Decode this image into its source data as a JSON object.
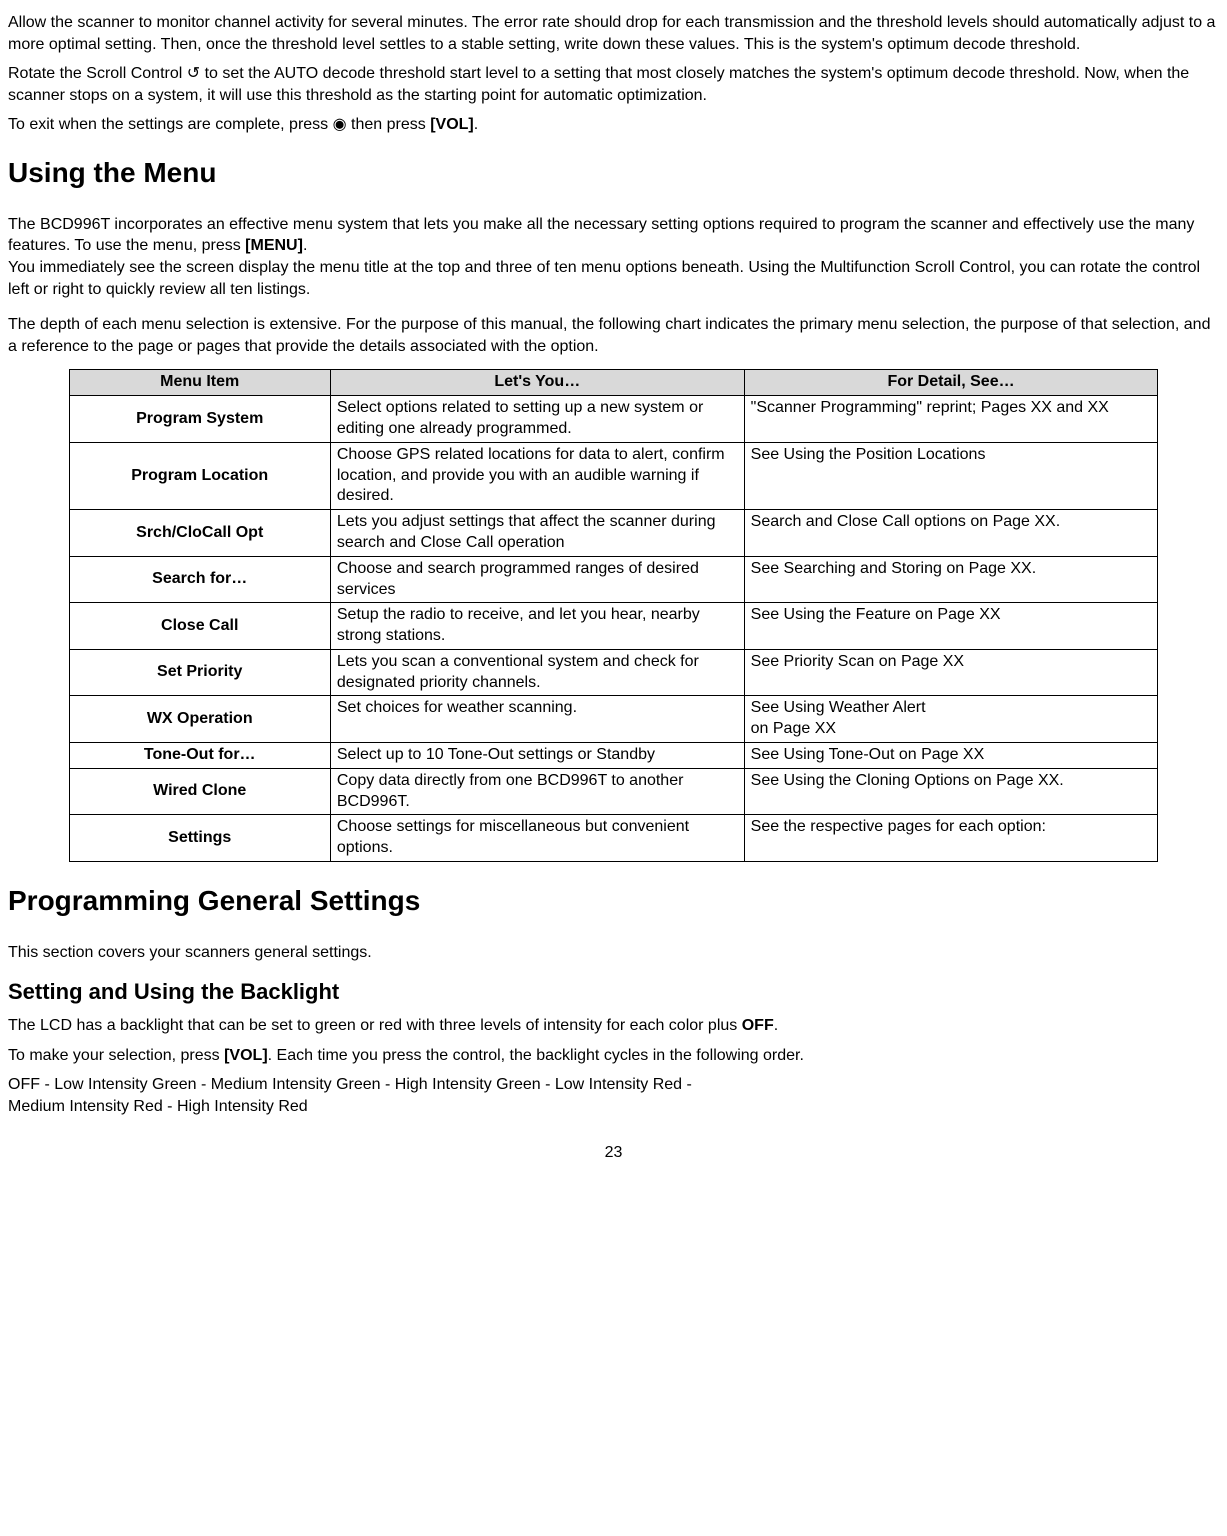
{
  "paragraphs": {
    "p1": "Allow the scanner to monitor channel activity for several minutes. The error rate should drop for each transmission and the threshold levels should automatically adjust to a more optimal setting. Then, once the threshold level settles to a stable setting, write down these values. This is the system's optimum decode threshold.",
    "p2_before": "Rotate the Scroll Control ",
    "p2_icon": "↺",
    "p2_after": " to set the AUTO decode threshold start level to a setting that most closely matches the system's optimum decode threshold. Now, when the scanner stops on a system, it will use this threshold as the starting point for automatic optimization.",
    "p3_before": "To exit when the settings are complete, press ",
    "p3_icon": "◉",
    "p3_mid": " then press ",
    "p3_bold": "[VOL]",
    "p3_after": ".",
    "p4_before": "The BCD996T incorporates an effective menu system that lets you make all the necessary setting options required to program the scanner and effectively use the many features. To use the menu, press ",
    "p4_bold": "[MENU]",
    "p4_after": ".",
    "p5": "You immediately see the screen display the menu title at the top and three of ten menu options beneath. Using the Multifunction Scroll Control, you can rotate the control left or right to quickly review all ten listings.",
    "p6": "The depth of each menu selection is extensive. For the purpose of this manual, the following chart indicates the primary menu selection, the purpose of that selection, and a reference to the page or pages that provide the details associated with the option.",
    "p7": "This section covers your scanners general settings.",
    "p8_before": "The LCD has a backlight that can be set to green or red with three levels of intensity for each color plus ",
    "p8_bold": "OFF",
    "p8_after": ".",
    "p9_before": "To make your selection, press ",
    "p9_bold": "[VOL]",
    "p9_after": ". Each time you press the control, the backlight cycles in the following order.",
    "p10a": "OFF - Low Intensity Green - Medium Intensity Green - High Intensity Green - Low Intensity Red -",
    "p10b": "Medium Intensity Red - High Intensity Red"
  },
  "headings": {
    "h1": "Using the Menu",
    "h2": "Programming General Settings",
    "h3": "Setting and Using the Backlight"
  },
  "table": {
    "headers": {
      "c1": "Menu Item",
      "c2": "Let's You…",
      "c3": "For Detail, See…"
    },
    "rows": [
      {
        "item": "Program System",
        "lets": "Select options related to setting up a new system or editing one already programmed.",
        "detail": "\"Scanner Programming\" reprint; Pages XX and XX"
      },
      {
        "item": "Program Location",
        "lets": "Choose GPS related locations for data to alert, confirm location, and provide you with an audible warning if desired.",
        "detail": "See Using the Position Locations"
      },
      {
        "item": "Srch/CloCall Opt",
        "lets": "Lets you adjust settings that affect the scanner during search and Close Call operation",
        "detail": "Search and Close Call options on Page XX."
      },
      {
        "item": "Search for…",
        "lets": "Choose and search programmed ranges of desired services",
        "detail": "See Searching and Storing on Page XX."
      },
      {
        "item": "Close Call",
        "lets": "Setup the radio to receive, and let you hear, nearby strong stations.",
        "detail": "See Using the Feature on Page XX"
      },
      {
        "item": "Set Priority",
        "lets": "Lets you scan a conventional system and check for designated priority channels.",
        "detail": "See Priority Scan on Page XX"
      },
      {
        "item": "WX Operation",
        "lets": "Set choices for weather scanning.",
        "detail": "See Using Weather Alert\non Page XX"
      },
      {
        "item": "Tone-Out for…",
        "lets": "Select up to 10 Tone-Out settings or Standby",
        "detail": "See Using Tone-Out on Page XX"
      },
      {
        "item": "Wired Clone",
        "lets": "Copy data directly from one BCD996T to another BCD996T.",
        "detail": "See Using the Cloning Options on Page XX."
      },
      {
        "item": "Settings",
        "lets": "Choose settings for miscellaneous but convenient options.",
        "detail": "See the respective pages for each option:"
      }
    ]
  },
  "pageNumber": "23"
}
